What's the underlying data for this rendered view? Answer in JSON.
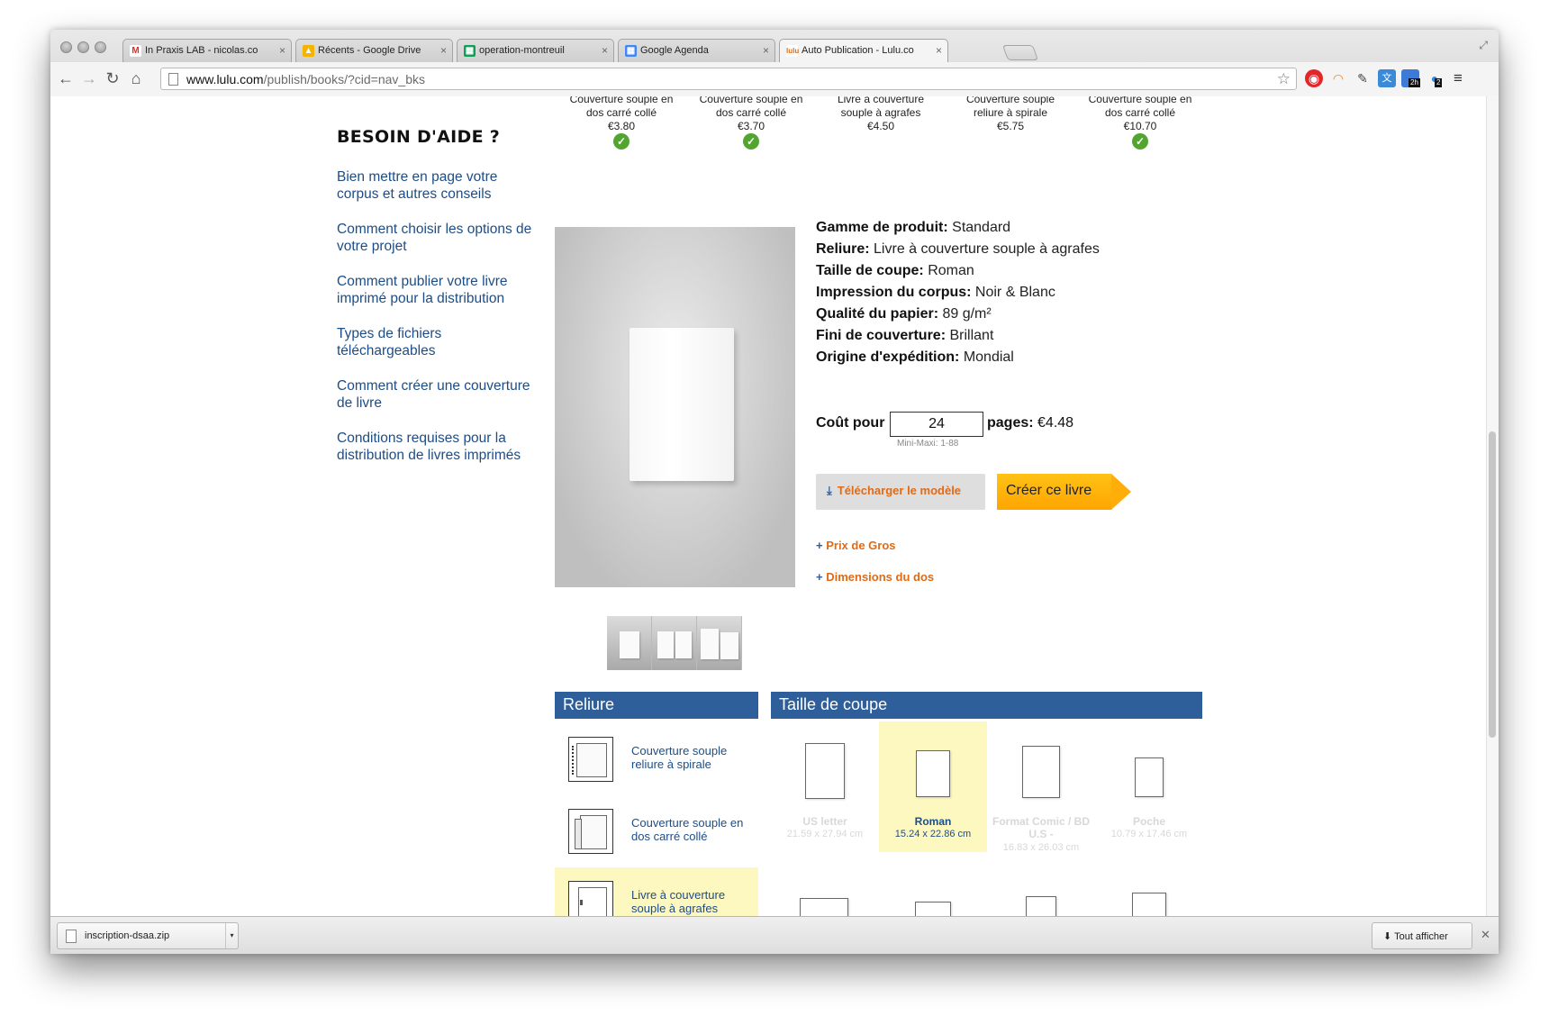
{
  "browser": {
    "tabs": [
      {
        "label": "In Praxis LAB - nicolas.co",
        "favicon": "gmail-icon",
        "color": "#d93025"
      },
      {
        "label": "Récents - Google Drive",
        "favicon": "drive-icon",
        "color": "#f4b400"
      },
      {
        "label": "operation-montreuil",
        "favicon": "sheets-icon",
        "color": "#0f9d58"
      },
      {
        "label": "Google Agenda",
        "favicon": "calendar-icon",
        "color": "#4285f4"
      },
      {
        "label": "Auto Publication - Lulu.co",
        "favicon": "lulu-icon",
        "color": "#e06a16"
      }
    ],
    "url_host": "www.lulu.com",
    "url_path": "/publish/books/?cid=nav_bks",
    "ext_badges": {
      "calendar": "2h",
      "notifications": "2"
    }
  },
  "help": {
    "title": "BESOIN D'AIDE ?",
    "links": [
      "Bien mettre en page votre corpus et autres conseils",
      "Comment choisir les options de votre projet",
      "Comment publier votre livre imprimé pour la distribution",
      "Types de fichiers téléchargeables",
      "Comment créer une couverture de livre",
      "Conditions requises pour la distribution de livres imprimés"
    ]
  },
  "top_options": [
    {
      "line1": "Couverture souple en",
      "line2": "dos carré collé",
      "price": "€3.80",
      "check": true
    },
    {
      "line1": "Couverture souple en",
      "line2": "dos carré collé",
      "price": "€3.70",
      "check": true
    },
    {
      "line1": "Livre à couverture",
      "line2": "souple à agrafes",
      "price": "€4.50",
      "check": false
    },
    {
      "line1": "Couverture souple",
      "line2": "reliure à spirale",
      "price": "€5.75",
      "check": false
    },
    {
      "line1": "Couverture souple en",
      "line2": "dos carré collé",
      "price": "€10.70",
      "check": true
    }
  ],
  "specs": [
    {
      "label": "Gamme de produit:",
      "value": "Standard"
    },
    {
      "label": "Reliure:",
      "value": "Livre à couverture souple à agrafes"
    },
    {
      "label": "Taille de coupe:",
      "value": "Roman"
    },
    {
      "label": "Impression du corpus:",
      "value": "Noir & Blanc"
    },
    {
      "label": "Qualité du papier:",
      "value": "89 g/m²"
    },
    {
      "label": "Fini de couverture:",
      "value": "Brillant"
    },
    {
      "label": "Origine d'expédition:",
      "value": "Mondial"
    }
  ],
  "cost": {
    "label": "Coût pour",
    "pages_value": "24",
    "pages_label": "pages:",
    "price": "€4.48",
    "hint": "Mini-Maxi: 1-88"
  },
  "actions": {
    "download_template": "Télécharger le modèle",
    "create_book": "Créer ce livre",
    "bulk_price": "Prix de Gros",
    "spine_dims": "Dimensions du dos"
  },
  "binding_panel": {
    "title": "Reliure",
    "options": [
      {
        "label": "Couverture souple reliure à spirale",
        "selected": false
      },
      {
        "label": "Couverture souple en dos carré collé",
        "selected": false
      },
      {
        "label": "Livre à couverture souple à agrafes",
        "selected": true
      }
    ]
  },
  "size_panel": {
    "title": "Taille de coupe",
    "options": [
      {
        "name": "US letter",
        "dims": "21.59 x 27.94 cm",
        "selected": false
      },
      {
        "name": "Roman",
        "dims": "15.24 x 22.86 cm",
        "selected": true
      },
      {
        "name": "Format Comic / BD U.S -",
        "dims": "16.83 x 26.03 cm",
        "selected": false
      },
      {
        "name": "Poche",
        "dims": "10.79 x 17.46 cm",
        "selected": false
      }
    ]
  },
  "downloads": {
    "file": "inscription-dsaa.zip",
    "show_all": "Tout afficher"
  }
}
